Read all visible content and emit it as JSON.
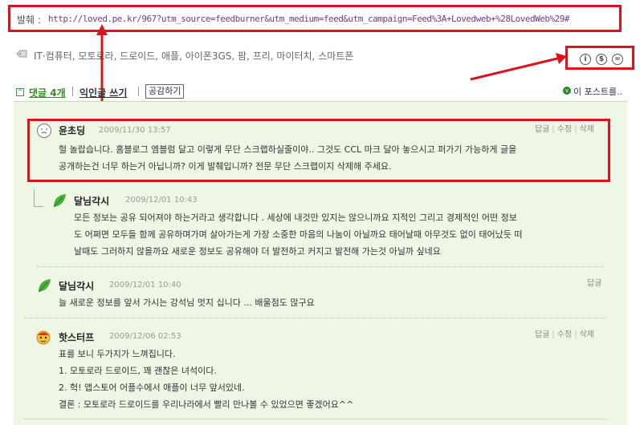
{
  "source": {
    "label": "발췌 :",
    "url": "http://loved.pe.kr/967?utm_source=feedburner&utm_medium=feed&utm_campaign=Feed%3A+Lovedweb+%28LovedWeb%29#"
  },
  "tags": "IT·컴퓨터, 모토로라, 드로이드, 애플, 아이폰3GS, 팜, 프리, 마이터치, 스마트폰",
  "license_icons": [
    "by-icon",
    "nc-icon",
    "nd-icon"
  ],
  "comment_header": {
    "toggle": "^",
    "count_label": "댓글 4개",
    "anon_label": "익인글 쓰기",
    "empathy_label": "공감하기",
    "post_link": "이 포스트를..",
    "post_icon": "v"
  },
  "comments": [
    {
      "author": "윤초딩",
      "date": "2009/11/30 13:57",
      "actions": [
        "답글",
        "수정",
        "삭제"
      ],
      "lines": [
        "헐 놀랍습니다. 홈블로그 엠블럼 달고 이렇게 무단 스크랩하실줄이야.. 그것도 CCL 마크 달아 놓으시고 퍼가기 가능하게 글을",
        "공개하는건 너무 하는거 아닙니까? 이게 발췌입니까? 전문 무단 스크랩이지 삭제해 주세요."
      ]
    },
    {
      "author": "달님각시",
      "date": "2009/12/01 10:43",
      "actions": [],
      "lines": [
        "모든 정보는 공유 되어져야 하는거라고 생각합니다 . 세상에 내것만 있지는 않으니까요 지적인 그리고 경제적인 어떤 정보",
        "도 어쩌면 모두들 함께 공유하며가며 살아가는게 가장 소중한 마음의 나눔이 아닐까요 태어날때 아무것도 없이 태어났듯 떠",
        "날때도 그러하지 않을까요 새로운 정보도 공유해야 더 발전하고 커지고 발전해 가는것 아닐까 싶네요"
      ]
    },
    {
      "author": "달님각시",
      "date": "2009/12/01 10:40",
      "actions": [
        "답글"
      ],
      "lines": [
        "늘 새로운 정보를 앞서 가시는 강석님 멋지 십니다 ... 배울점도 많구요"
      ]
    },
    {
      "author": "핫스터프",
      "date": "2009/12/06 02:53",
      "actions": [
        "답글",
        "수정",
        "삭제"
      ],
      "lines": [
        "표를 보니 두가지가 느껴집니다.",
        "1. 모토로라 드로이드, 꽤 괜찮은 녀석이다.",
        "2. 헉! 앱스토어 어플수에서 애플이 너무 앞서있네.",
        "결론 : 모토로라 드로이드를 우리나라에서 빨리 만나볼 수 있었으면 좋겠어요^^"
      ]
    }
  ],
  "colors": {
    "highlight": "#d9141c",
    "accent_green": "#3a8a2a",
    "comment_bg": "#eef7e6",
    "url_color": "#6a3c8c"
  }
}
